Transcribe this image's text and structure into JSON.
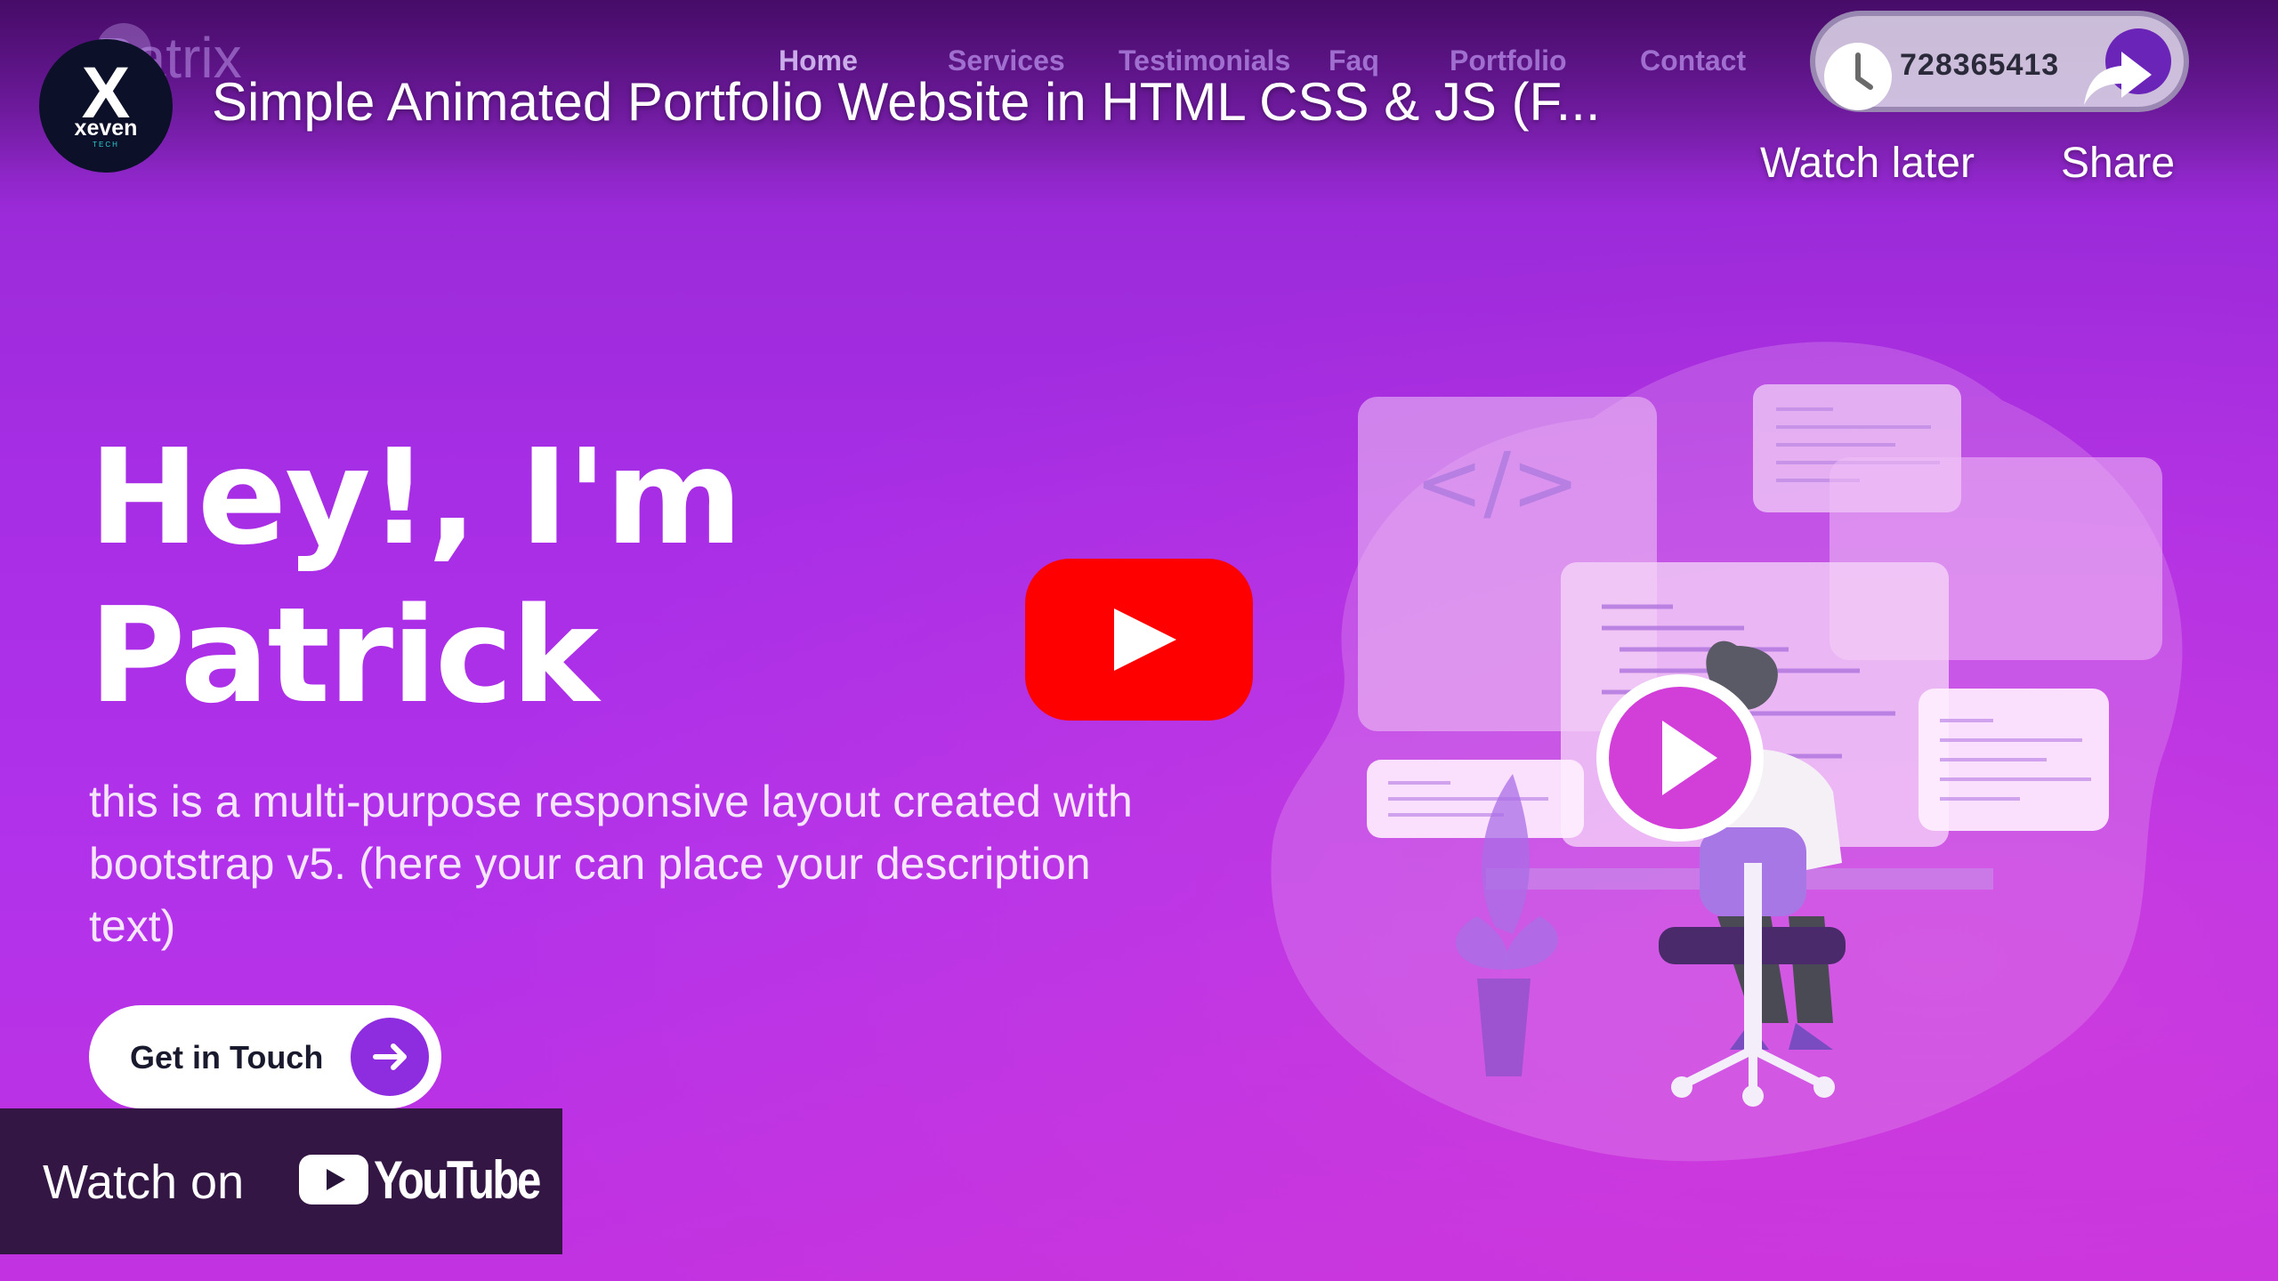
{
  "video": {
    "title": "Simple Animated Portfolio Website in HTML CSS & JS (F...",
    "channel_avatar": {
      "letter": "X",
      "name": "xeven",
      "subtitle": "TECH"
    }
  },
  "controls": {
    "watch_later_label": "Watch later",
    "share_label": "Share",
    "watch_later_icon": "clock-icon",
    "share_icon": "share-arrow-icon"
  },
  "site": {
    "logo": "Patrix",
    "nav": [
      "Home",
      "Services",
      "Testimonials",
      "Faq",
      "Portfolio",
      "Contact"
    ],
    "phone": "728365413",
    "hero": {
      "heading_line1": "Hey!, I'm",
      "heading_line2": "Patrick",
      "description": "this is a multi-purpose responsive layout created with bootstrap v5. (here your can place your description text)",
      "cta_label": "Get in Touch"
    }
  },
  "footer": {
    "watch_on_label": "Watch on",
    "youtube_wordmark": "YouTube"
  },
  "colors": {
    "youtube_red": "#ff0000",
    "accent_purple": "#8e2ce0",
    "illustration_magenta": "#d23ed8"
  }
}
